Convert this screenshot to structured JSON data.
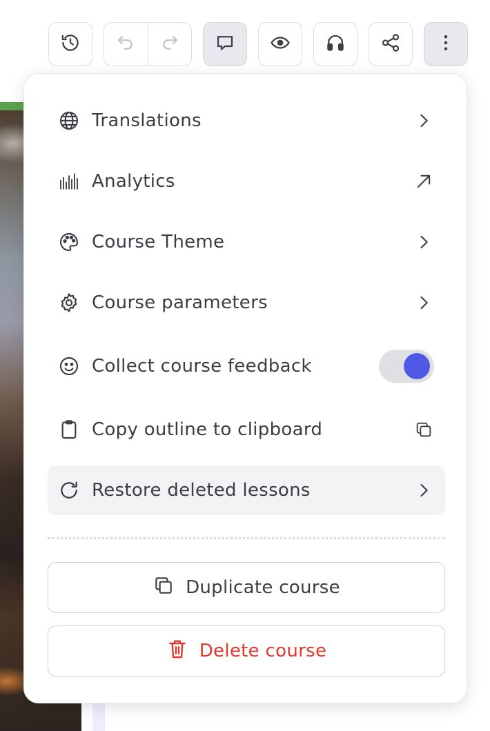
{
  "toolbar": {
    "buttons": [
      {
        "id": "history",
        "icon": "history-icon"
      },
      {
        "id": "undo",
        "icon": "undo-icon"
      },
      {
        "id": "redo",
        "icon": "redo-icon"
      },
      {
        "id": "comments",
        "icon": "comment-icon",
        "active": true
      },
      {
        "id": "preview",
        "icon": "eye-icon"
      },
      {
        "id": "audio",
        "icon": "headphones-icon"
      },
      {
        "id": "share",
        "icon": "share-icon"
      },
      {
        "id": "more",
        "icon": "more-vertical-icon"
      }
    ]
  },
  "menu": {
    "items": [
      {
        "label": "Translations",
        "icon": "globe-icon",
        "trailing": "chevron-right-icon"
      },
      {
        "label": "Analytics",
        "icon": "analytics-icon",
        "trailing": "arrow-up-right-icon"
      },
      {
        "label": "Course Theme",
        "icon": "palette-icon",
        "trailing": "chevron-right-icon"
      },
      {
        "label": "Course parameters",
        "icon": "gear-icon",
        "trailing": "chevron-right-icon"
      },
      {
        "label": "Collect course feedback",
        "icon": "smiley-icon",
        "trailing": "toggle",
        "toggle_on": true
      },
      {
        "label": "Copy outline to clipboard",
        "icon": "clipboard-icon",
        "trailing": "copy-icon"
      },
      {
        "label": "Restore deleted lessons",
        "icon": "restore-icon",
        "trailing": "chevron-right-icon",
        "highlighted": true
      }
    ],
    "duplicate_label": "Duplicate course",
    "delete_label": "Delete course"
  },
  "colors": {
    "accent": "#4f59e6",
    "danger": "#e03a2f",
    "text": "#3b3d44",
    "hover_bg": "#f2f3f5"
  }
}
